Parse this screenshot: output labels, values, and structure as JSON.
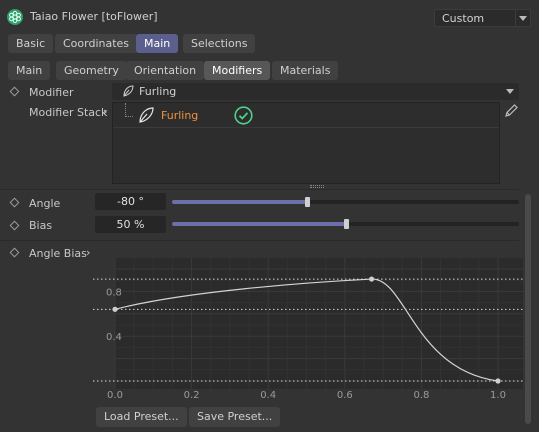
{
  "header": {
    "title": "Taiao Flower [toFlower]",
    "layout_dropdown": "Custom"
  },
  "tabs_row1": [
    "Basic",
    "Coordinates",
    "Main",
    "Selections"
  ],
  "tabs_row1_selected": "Main",
  "tabs_row2": [
    "Main",
    "Geometry",
    "Orientation",
    "Modifiers",
    "Materials"
  ],
  "tabs_row2_selected": "Modifiers",
  "modifier": {
    "label": "Modifier",
    "value": "Furling"
  },
  "modifier_stack": {
    "label": "Modifier Stack",
    "items": [
      {
        "name": "Furling",
        "enabled": true
      }
    ]
  },
  "angle": {
    "label": "Angle",
    "value": "-80 °",
    "slider_fraction": 0.39
  },
  "bias": {
    "label": "Bias",
    "value": "50 %",
    "slider_fraction": 0.5
  },
  "angle_bias": {
    "label": "Angle Bias",
    "y_ticks": [
      "0.8",
      "0.4"
    ],
    "x_ticks": [
      "0.0",
      "0.2",
      "0.4",
      "0.6",
      "0.8",
      "1.0"
    ],
    "curve_points": [
      {
        "x": 0.0,
        "y": 0.64
      },
      {
        "x": 0.67,
        "y": 0.91
      },
      {
        "x": 1.0,
        "y": 0.0
      }
    ]
  },
  "buttons": {
    "load_preset": "Load Preset...",
    "save_preset": "Save Preset..."
  },
  "colors": {
    "accent_tab": "#5b5f8e",
    "slider_fill": "#6b70a8",
    "stack_item": "#f0913a",
    "check": "#4fd18a"
  }
}
